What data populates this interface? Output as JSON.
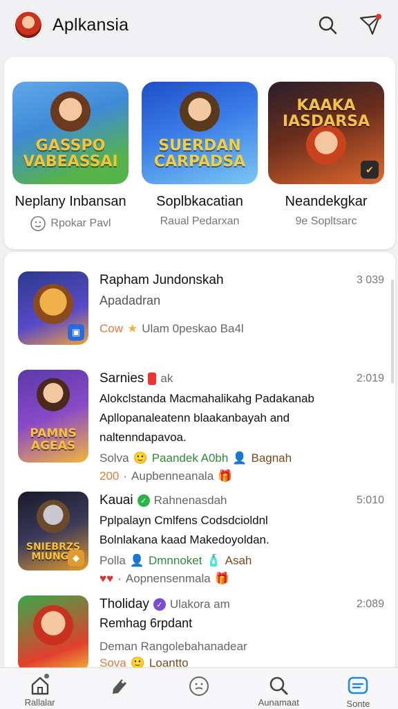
{
  "header": {
    "title": "Aplkansia",
    "icons": [
      "avatar",
      "search-icon",
      "send-icon"
    ],
    "notification_color": "#e3342f"
  },
  "featured": [
    {
      "thumb_text": "GASSPO\nVABEASSAI",
      "name": "Neplany Inbansan",
      "sub": "Rpokar Pavl",
      "colors": [
        "#3f8ad8",
        "#56b34a",
        "#f2b53a"
      ]
    },
    {
      "thumb_text": "SUERDAN\nCARPADSA",
      "name": "Soplbkacatian",
      "sub": "Raual Pedarxan",
      "colors": [
        "#2a5fd6",
        "#7bc6f2",
        "#f4cf3d"
      ]
    },
    {
      "thumb_text": "KAAKA\nIASDARSA",
      "name": "Neandekgkar",
      "sub": "9e Sopltsarc",
      "colors": [
        "#3a2a2a",
        "#e0692e",
        "#f2c14b"
      ]
    }
  ],
  "list": [
    {
      "thumb_text": "",
      "title": "Rapham Jundonskah",
      "title_extra": "",
      "sub": "Apadadran",
      "desc": [],
      "meta1": [
        "Cow",
        "★",
        "Ulam 0peskao Ba4l"
      ],
      "meta2": [],
      "time": "3 039",
      "colors": [
        "#2b3a8c",
        "#f2a13a"
      ]
    },
    {
      "thumb_text": "PAMNS\nAGEAS",
      "title": "Sarnies",
      "title_extra": "ak",
      "sub": "",
      "desc": [
        "Alokclstanda Macmahalikahg Padakanab",
        "Apllopanaleatenn blaakanbayah and",
        "naltenndapavoa."
      ],
      "meta1": [
        "Solva",
        "Paandek A0bh",
        "Bagnah"
      ],
      "meta2": [
        "200",
        "Aupbenneanala"
      ],
      "time": "2:019",
      "colors": [
        "#5a3aa8",
        "#f2b53a"
      ]
    },
    {
      "thumb_text": "SNIEBRZS\nMIUNGE",
      "title": "Kauai",
      "title_extra": "Rahnenasdah",
      "sub": "",
      "desc": [
        "Pplpalayn Cmlfens Codsdcioldnl",
        "Bolnlakana kaad Makedoyoldan."
      ],
      "meta1": [
        "Polla",
        "Dmnnoket",
        "Asah"
      ],
      "meta2": [
        "♥♥",
        "Aopnensenmala"
      ],
      "time": "5:010",
      "colors": [
        "#2a2a3a",
        "#e09a2e"
      ]
    },
    {
      "thumb_text": "",
      "title": "Tholiday",
      "title_extra": "Ulakora am",
      "sub": "Remhag 6rpdant",
      "desc": [],
      "meta1": [
        "Deman Rangolebahanadear"
      ],
      "meta2": [
        "Sova",
        "Loantto"
      ],
      "time": "2:089",
      "colors": [
        "#3aa84a",
        "#e0402e"
      ]
    }
  ],
  "bottom_nav": [
    {
      "label": "Rallalar",
      "icon": "home-icon"
    },
    {
      "label": "",
      "icon": "pencil-tag-icon"
    },
    {
      "label": "",
      "icon": "smiley-icon"
    },
    {
      "label": "Aunamaat",
      "icon": "search-icon"
    },
    {
      "label": "Sonte",
      "icon": "message-icon",
      "active": true,
      "active_color": "#1e88e5"
    }
  ]
}
